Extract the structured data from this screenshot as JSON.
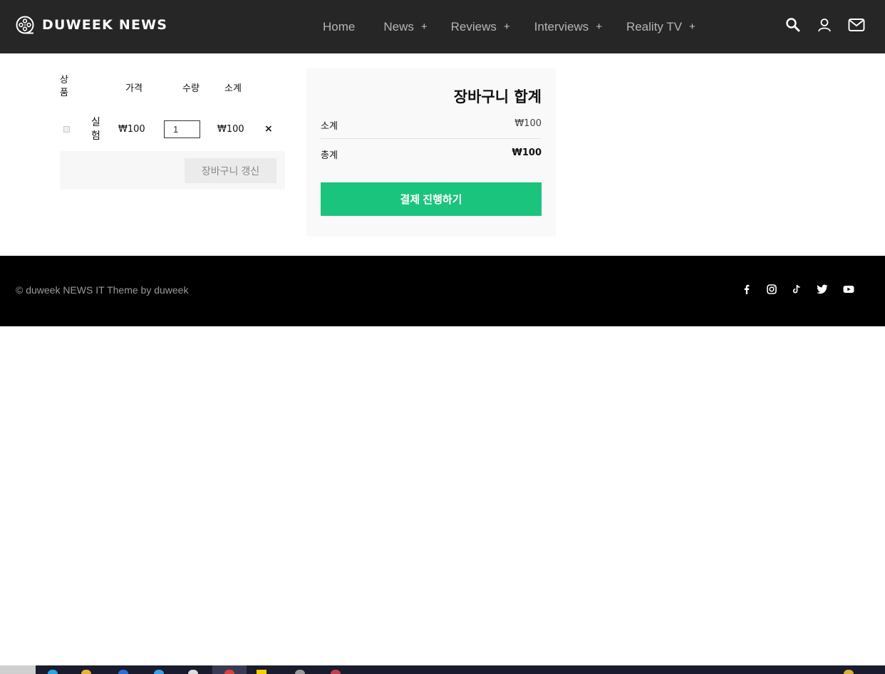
{
  "header": {
    "brand": "DUWEEK NEWS",
    "nav": [
      {
        "label": "Home",
        "has_submenu": false
      },
      {
        "label": "News",
        "has_submenu": true
      },
      {
        "label": "Reviews",
        "has_submenu": true
      },
      {
        "label": "Interviews",
        "has_submenu": true
      },
      {
        "label": "Reality TV",
        "has_submenu": true
      }
    ],
    "submenu_symbol": "+",
    "icons": [
      "search-icon",
      "user-icon",
      "mail-icon"
    ]
  },
  "cart": {
    "headers": {
      "product": "상품",
      "price": "가격",
      "quantity": "수량",
      "subtotal": "소계"
    },
    "items": [
      {
        "name": "실험",
        "price": "₩100",
        "quantity": "1",
        "subtotal": "₩100",
        "remove": "×"
      }
    ],
    "update_button": "장바구니 갱신"
  },
  "totals": {
    "title": "장바구니 합계",
    "subtotal_label": "소계",
    "subtotal_value": "₩100",
    "total_label": "총계",
    "total_value": "₩100",
    "checkout_button": "결제 진행하기"
  },
  "footer": {
    "copyright": "© duweek NEWS IT Theme by duweek",
    "social": [
      "facebook-icon",
      "instagram-icon",
      "tiktok-icon",
      "twitter-icon",
      "youtube-icon"
    ]
  },
  "colors": {
    "header_bg": "#262626",
    "accent": "#1bc47d",
    "footer_bg": "#000000"
  }
}
